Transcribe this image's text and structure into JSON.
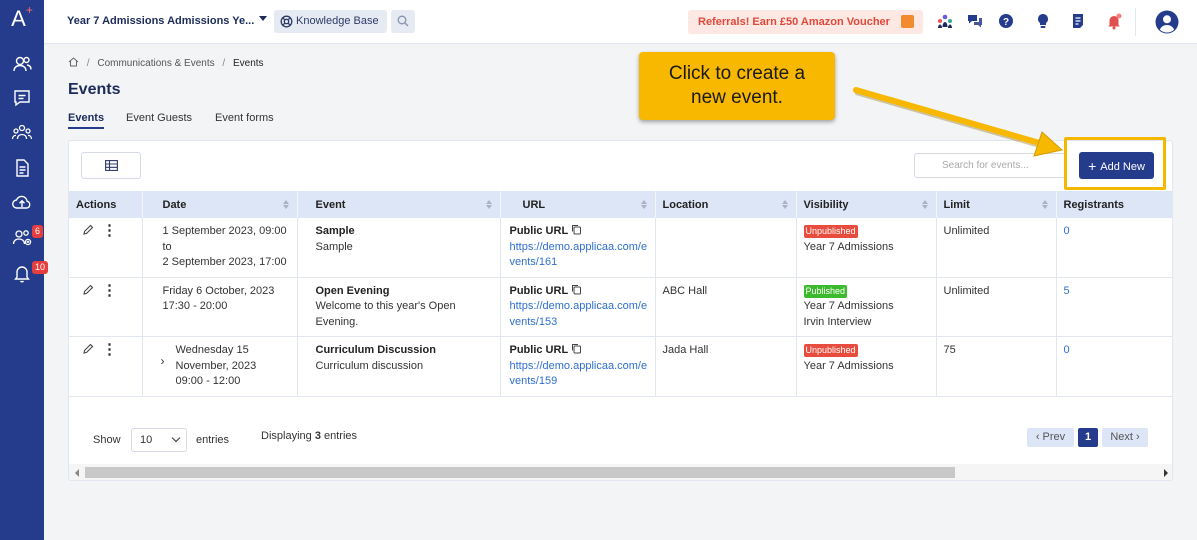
{
  "sidebar": {
    "logo": "A",
    "logo_plus": "+",
    "badges": {
      "applicants": "6",
      "notifications": "10"
    }
  },
  "topbar": {
    "campaign": "Year 7 Admissions Admissions Ye...",
    "knowledge_base": "Knowledge Base",
    "referral": "Referrals! Earn £50 Amazon Voucher"
  },
  "breadcrumb": {
    "parent": "Communications & Events",
    "current": "Events"
  },
  "page_title": "Events",
  "tabs": [
    "Events",
    "Event Guests",
    "Event forms"
  ],
  "toolbar": {
    "search_placeholder": "Search for events...",
    "add_label": "Add New"
  },
  "table": {
    "columns": [
      "Actions",
      "Date",
      "Event",
      "URL",
      "Location",
      "Visibility",
      "Limit",
      "Registrants"
    ],
    "rows": [
      {
        "date_lines": [
          "1 September 2023, 09:00",
          "to",
          "2 September 2023, 17:00"
        ],
        "event_name": "Sample",
        "event_desc": "Sample",
        "url_label": "Public URL",
        "url": "https://demo.applicaa.com/events/161",
        "location": "",
        "status": "Unpublished",
        "visibility_lines": [
          "Year 7 Admissions"
        ],
        "limit": "Unlimited",
        "registrants": "0"
      },
      {
        "date_lines": [
          "Friday 6 October, 2023",
          "17:30 - 20:00"
        ],
        "event_name": "Open Evening",
        "event_desc": "Welcome to this year's Open Evening.",
        "url_label": "Public URL",
        "url": "https://demo.applicaa.com/events/153",
        "location": "ABC Hall",
        "status": "Published",
        "visibility_lines": [
          "Year 7 Admissions",
          "Irvin Interview"
        ],
        "limit": "Unlimited",
        "registrants": "5"
      },
      {
        "date_lines": [
          "Wednesday 15",
          "November, 2023",
          "09:00 - 12:00"
        ],
        "event_name": "Curriculum Discussion",
        "event_desc": "Curriculum discussion",
        "url_label": "Public URL",
        "url": "https://demo.applicaa.com/events/159",
        "location": "Jada Hall",
        "status": "Unpublished",
        "visibility_lines": [
          "Year 7 Admissions"
        ],
        "limit": "75",
        "registrants": "0"
      }
    ]
  },
  "footer": {
    "show": "Show",
    "page_length": "10",
    "entries": "entries",
    "displaying_prefix": "Displaying",
    "displaying_count": "3",
    "displaying_suffix": "entries",
    "prev": "‹ Prev",
    "page": "1",
    "next": "Next ›"
  },
  "callout": {
    "line1": "Click to create a",
    "line2": "new event."
  },
  "colors": {
    "sidebar": "#253b8c",
    "accent": "#253b8c",
    "callout": "#f8b800",
    "unpublished": "#e74c3c",
    "published": "#3cba2e",
    "link": "#2f6fcf"
  }
}
